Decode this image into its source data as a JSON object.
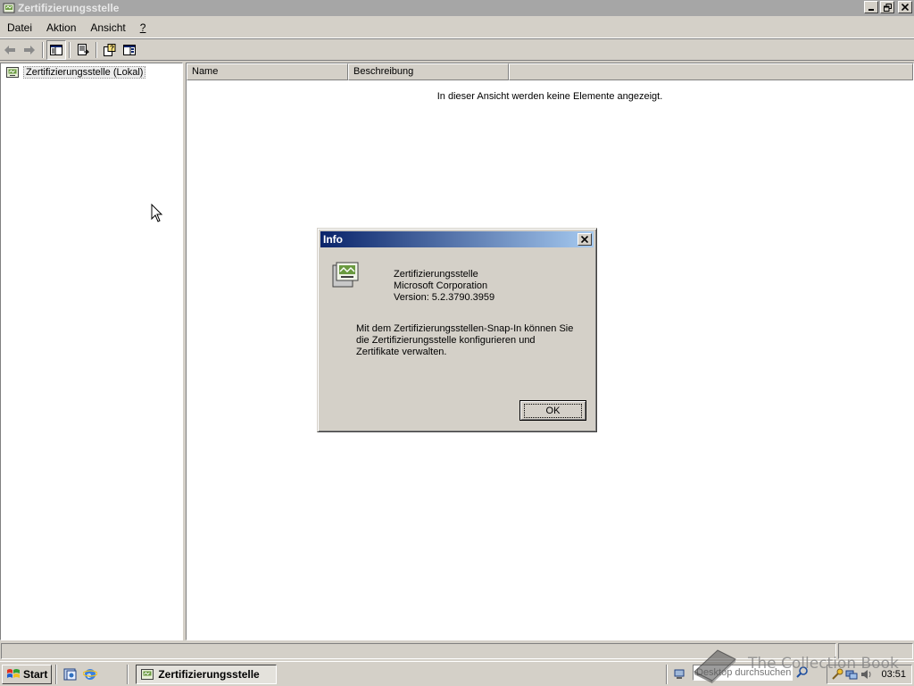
{
  "window": {
    "title": "Zertifizierungsstelle",
    "buttons": [
      "minimize",
      "restore",
      "close"
    ]
  },
  "menu": {
    "items": [
      "Datei",
      "Aktion",
      "Ansicht",
      "?"
    ]
  },
  "toolbar": {
    "buttons": [
      "back-icon",
      "forward-icon",
      "show-hide-tree-icon",
      "export-list-icon",
      "help-icon",
      "action-pane-icon"
    ]
  },
  "tree": {
    "root_label": "Zertifizierungsstelle (Lokal)"
  },
  "list": {
    "columns": [
      "Name",
      "Beschreibung"
    ],
    "empty_message": "In dieser Ansicht werden keine Elemente angezeigt."
  },
  "dialog": {
    "title": "Info",
    "product": "Zertifizierungsstelle",
    "company": "Microsoft Corporation",
    "version": "Version: 5.2.3790.3959",
    "description": "Mit dem Zertifizierungsstellen-Snap-In können Sie die Zertifizierungsstelle konfigurieren und Zertifikate verwalten.",
    "ok_label": "OK"
  },
  "taskbar": {
    "start_label": "Start",
    "task_label": "Zertifizierungsstelle",
    "search_placeholder": "Desktop durchsuchen",
    "clock": "03:51"
  },
  "watermark": {
    "text": "The Collection Book"
  },
  "colors": {
    "title_inactive": "#a6a6a6",
    "dialog_title_start": "#0a246a",
    "dialog_title_end": "#a6caf0",
    "face": "#d4d0c8"
  }
}
